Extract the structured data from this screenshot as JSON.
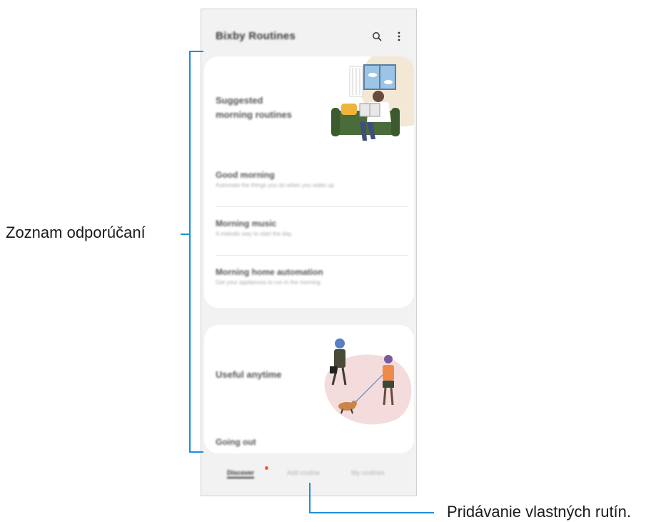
{
  "app": {
    "title": "Bixby Routines",
    "search_icon": "search-icon",
    "more_icon": "more-vertical-icon"
  },
  "card1": {
    "heading": "Suggested\nmorning routines",
    "items": [
      {
        "title": "Good morning",
        "subtitle": "Automate the things you do when you wake up"
      },
      {
        "title": "Morning music",
        "subtitle": "A melodic way to start the day."
      },
      {
        "title": "Morning home automation",
        "subtitle": "Get your appliances to run in the morning"
      }
    ]
  },
  "card2": {
    "heading": "Useful anytime",
    "items": [
      {
        "title": "Going out"
      }
    ]
  },
  "tabs": [
    {
      "label": "Discover"
    },
    {
      "label": "Add routine"
    },
    {
      "label": "My routines"
    }
  ],
  "callouts": {
    "recommendations": "Zoznam odporúčaní",
    "add_routine": "Pridávanie vlastných rutín."
  },
  "colors": {
    "callout_line": "#1e8fd6",
    "notification_dot": "#ff5a1f",
    "sofa": "#4a6b3a",
    "accent_blob": "#f3e7d6",
    "pink_blob": "#f5dcdc"
  }
}
